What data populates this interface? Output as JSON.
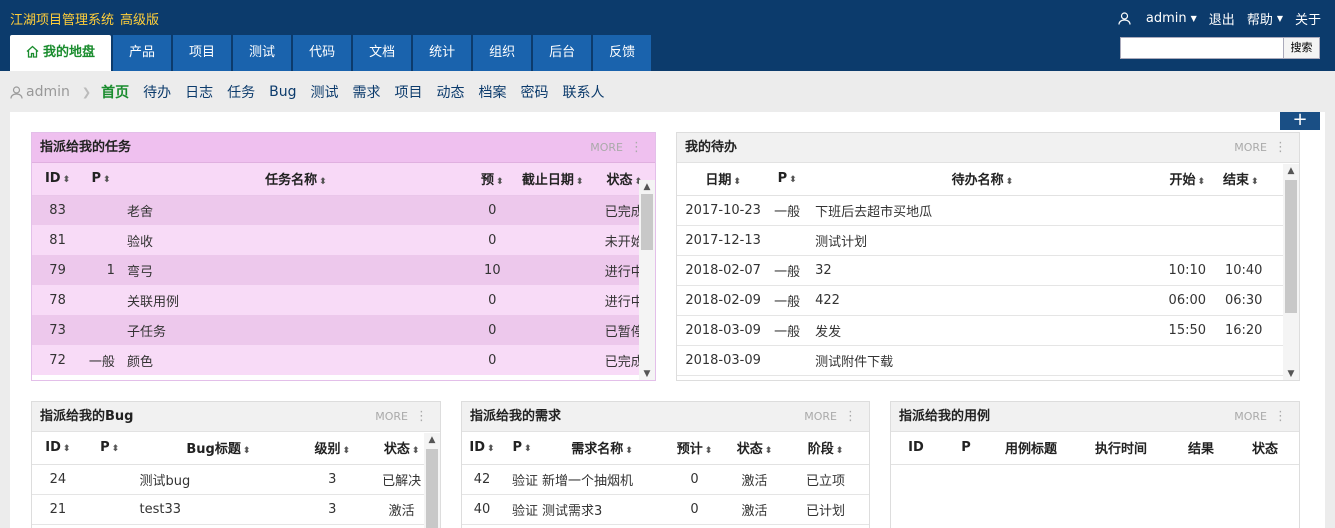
{
  "app": {
    "title": "江湖项目管理系统",
    "edition": "高级版"
  },
  "topright": {
    "user": "admin",
    "logout": "退出",
    "help": "帮助",
    "about": "关于"
  },
  "mainnav": [
    "我的地盘",
    "产品",
    "项目",
    "测试",
    "代码",
    "文档",
    "统计",
    "组织",
    "后台",
    "反馈"
  ],
  "search": {
    "button": "搜索",
    "value": ""
  },
  "subnav": {
    "user": "admin",
    "items": [
      "首页",
      "待办",
      "日志",
      "任务",
      "Bug",
      "测试",
      "需求",
      "项目",
      "动态",
      "档案",
      "密码",
      "联系人"
    ]
  },
  "more": "MORE",
  "tasks": {
    "title": "指派给我的任务",
    "headers": [
      "ID",
      "P",
      "任务名称",
      "预",
      "截止日期",
      "状态"
    ],
    "rows": [
      [
        "83",
        "",
        "老舍",
        "0",
        "",
        "已完成"
      ],
      [
        "81",
        "",
        "验收",
        "0",
        "",
        "未开始"
      ],
      [
        "79",
        "1",
        "弯弓",
        "10",
        "",
        "进行中"
      ],
      [
        "78",
        "",
        "关联用例",
        "0",
        "",
        "进行中"
      ],
      [
        "73",
        "",
        "子任务",
        "0",
        "",
        "已暂停"
      ],
      [
        "72",
        "一般",
        "颜色",
        "0",
        "",
        "已完成"
      ]
    ]
  },
  "todos": {
    "title": "我的待办",
    "headers": [
      "日期",
      "P",
      "待办名称",
      "开始",
      "结束"
    ],
    "rows": [
      [
        "2017-10-23",
        "一般",
        "下班后去超市买地瓜",
        "",
        ""
      ],
      [
        "2017-12-13",
        "",
        "测试计划",
        "",
        ""
      ],
      [
        "2018-02-07",
        "一般",
        "32",
        "10:10",
        "10:40"
      ],
      [
        "2018-02-09",
        "一般",
        "422",
        "06:00",
        "06:30"
      ],
      [
        "2018-03-09",
        "一般",
        "发发",
        "15:50",
        "16:20"
      ],
      [
        "2018-03-09",
        "",
        "测试附件下载",
        "",
        ""
      ]
    ]
  },
  "bugs": {
    "title": "指派给我的Bug",
    "headers": [
      "ID",
      "P",
      "Bug标题",
      "级别",
      "状态"
    ],
    "rows": [
      [
        "24",
        "",
        "测试bug",
        "3",
        "已解决"
      ],
      [
        "21",
        "",
        "test33",
        "3",
        "激活"
      ]
    ]
  },
  "stories": {
    "title": "指派给我的需求",
    "headers": [
      "ID",
      "P",
      "需求名称",
      "预计",
      "状态",
      "阶段"
    ],
    "rows": [
      [
        "42",
        "验证",
        "新增一个抽烟机",
        "0",
        "激活",
        "已立项"
      ],
      [
        "40",
        "验证",
        "测试需求3",
        "0",
        "激活",
        "已计划"
      ]
    ]
  },
  "cases": {
    "title": "指派给我的用例",
    "headers": [
      "ID",
      "P",
      "用例标题",
      "执行时间",
      "结果",
      "状态"
    ],
    "rows": []
  },
  "colors": {
    "topbar": "#0c3b6c",
    "tab": "#1a63ad",
    "brand": "#ffce3a",
    "active_text": "#1a8c2e",
    "task_head": "#efc0ef"
  }
}
